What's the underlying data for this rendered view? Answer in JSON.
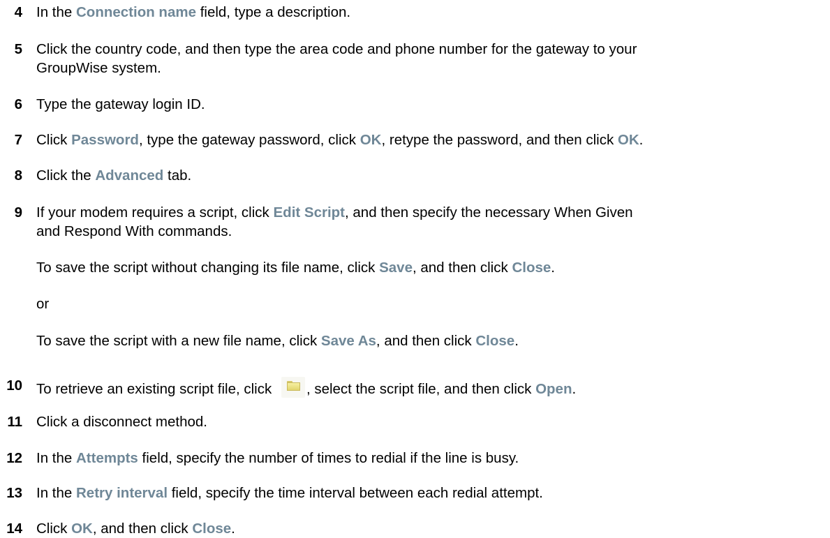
{
  "steps": [
    {
      "num": "4",
      "t1": "In the ",
      "ui1": "Connection name",
      "t2": " field, type a description."
    },
    {
      "num": "5",
      "t1": "Click the country code, and then type the area code and phone number for the gateway to your",
      "cont": "GroupWise system."
    },
    {
      "num": "6",
      "t1": "Type the gateway login ID."
    },
    {
      "num": "7",
      "t1": "Click ",
      "ui1": "Password",
      "t2": ", type the gateway password, click ",
      "ui2": "OK",
      "t3": ", retype the password, and then click ",
      "ui3": "OK",
      "t4": "."
    },
    {
      "num": "8",
      "t1": "Click the ",
      "ui1": "Advanced",
      "t2": " tab."
    },
    {
      "num": "9",
      "t1": "If your modem requires a script, click ",
      "ui1": "Edit Script",
      "t2": ", and then specify the necessary When Given",
      "cont": "and Respond With commands."
    },
    {
      "num": "10",
      "t1": "To retrieve an existing script file, click ",
      "t2": ", select the script file, and then click ",
      "ui1": "Open",
      "t3": "."
    },
    {
      "num": "11",
      "t1": "Click a disconnect method."
    },
    {
      "num": "12",
      "t1": "In the ",
      "ui1": "Attempts",
      "t2": " field, specify the number of times to redial if the line is busy."
    },
    {
      "num": "13",
      "t1": "In the ",
      "ui1": "Retry interval",
      "t2": " field, specify the time interval between each redial attempt."
    },
    {
      "num": "14",
      "t1": "Click ",
      "ui1": "OK",
      "t2": ", and then click ",
      "ui2": "Close",
      "t3": "."
    }
  ],
  "sub9": {
    "a": {
      "t1": "To save the script without changing its file name, click ",
      "ui1": "Save",
      "t2": ", and then click ",
      "ui2": "Close",
      "t3": "."
    },
    "or": "or",
    "b": {
      "t1": "To save the script with a new file name, click ",
      "ui1": "Save As",
      "t2": ", and then click ",
      "ui2": "Close",
      "t3": "."
    }
  },
  "icons": {
    "open_folder": "folder-icon"
  },
  "colors": {
    "ui_label": "#6f8797",
    "text": "#000000"
  }
}
